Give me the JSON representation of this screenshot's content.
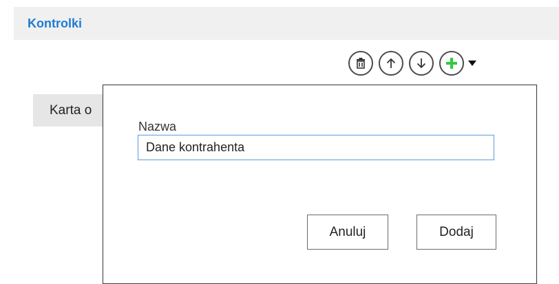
{
  "section": {
    "title": "Kontrolki"
  },
  "toolbar": {
    "buttons": [
      {
        "icon": "trash-icon"
      },
      {
        "icon": "arrow-up-icon"
      },
      {
        "icon": "arrow-down-icon"
      },
      {
        "icon": "plus-icon",
        "color": "#2ecc40"
      }
    ],
    "dropdown_icon": "caret-down-icon"
  },
  "list": {
    "items": [
      {
        "label": "Karta o"
      }
    ]
  },
  "dialog": {
    "field_label": "Nazwa",
    "field_value": "Dane kontrahenta",
    "cancel_label": "Anuluj",
    "add_label": "Dodaj"
  },
  "colors": {
    "accent": "#1e7bd2",
    "add_icon": "#2ecc40",
    "input_border": "#5b9bd5"
  }
}
